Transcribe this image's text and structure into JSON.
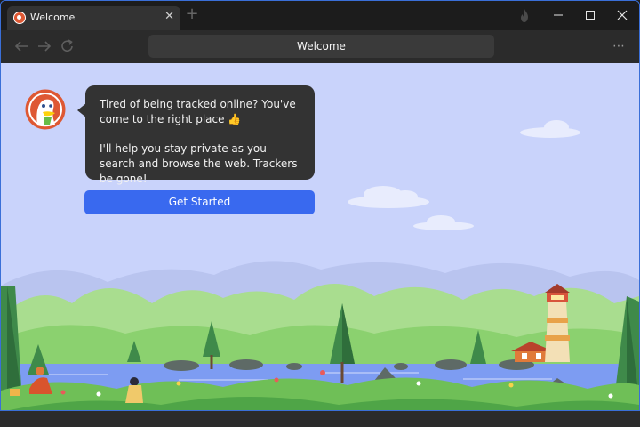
{
  "browser": {
    "tab": {
      "title": "Welcome",
      "close_glyph": "✕",
      "favicon": "duckduckgo-icon"
    },
    "new_tab_glyph": "+",
    "address_bar": {
      "value": "Welcome"
    },
    "more_glyph": "⋯",
    "icons": [
      "fire-icon",
      "minimize-icon",
      "maximize-icon",
      "close-icon",
      "back-arrow-icon",
      "forward-arrow-icon",
      "reload-icon"
    ]
  },
  "welcome": {
    "message_line1": "Tired of being tracked online?  You've come to the right place 👍",
    "message_line2": "I'll help you stay private as you search and browse the web. Trackers be gone!",
    "cta_label": "Get Started"
  },
  "colors": {
    "accent": "#3969ef",
    "brand": "#de5833",
    "content_bg": "#c9d3fb",
    "bubble_bg": "#333333"
  }
}
